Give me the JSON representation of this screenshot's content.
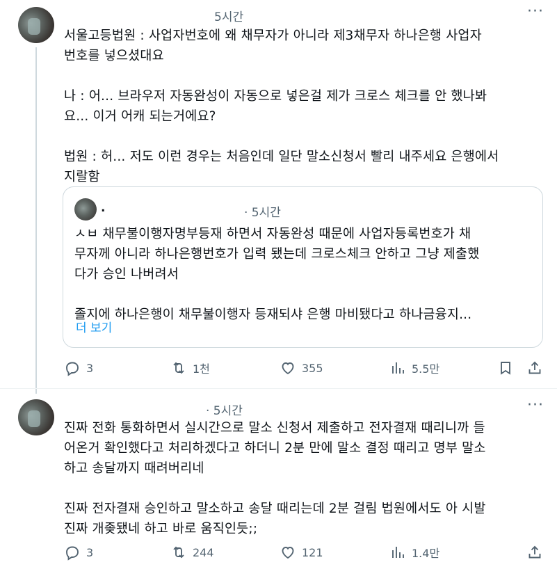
{
  "tweets": [
    {
      "timestamp": "5시간",
      "text": "서울고등법원 : 사업자번호에 왜 채무자가 아니라 제3채무자 하나은행 사업자\n번호를 넣으셨대요\n\n나 : 어... 브라우저 자동완성이 자동으로 넣은걸 제가 크로스 체크를 안 했나봐\n요... 이거 어캐 되는거에요?\n\n법원 : 허... 저도 이런 경우는 처음인데 일단 말소신청서 빨리 내주세요 은행에서\n지랄함",
      "quote": {
        "author": ".",
        "timestamp": "· 5시간",
        "text": "ㅅㅂ 채무불이행자명부등재 하면서 자동완성 때문에 사업자등록번호가 채\n무자께 아니라 하나은행번호가 입력 됐는데 크로스체크 안하고 그냥 제출했\n다가 승인 나버려서\n\n졸지에 하나은행이 채무불이행자 등재되샤 은행 마비됐다고 하나금융지...",
        "show_more": "더 보기"
      },
      "actions": {
        "replies": "3",
        "retweets": "1천",
        "likes": "355",
        "views": "5.5만"
      }
    },
    {
      "timestamp": "· 5시간",
      "text": "진짜 전화 통화하면서 실시간으로 말소 신청서 제출하고 전자결재 때리니까 들\n어온거 확인했다고 처리하겠다고 하더니 2분 만에 말소 결정 때리고 명부 말소\n하고 송달까지 때려버리네\n\n진짜 전자결재 승인하고 말소하고 송달 때리는데 2분 걸림 법원에서도 아 시발\n진짜 개좆됐네 하고 바로 움직인듯;;",
      "actions": {
        "replies": "3",
        "retweets": "244",
        "likes": "121",
        "views": "1.4만"
      }
    }
  ],
  "icons": {
    "reply": "reply-icon",
    "retweet": "retweet-icon",
    "like": "heart-icon",
    "views": "views-icon",
    "bookmark": "bookmark-icon",
    "share": "share-icon",
    "more": "more-icon"
  }
}
